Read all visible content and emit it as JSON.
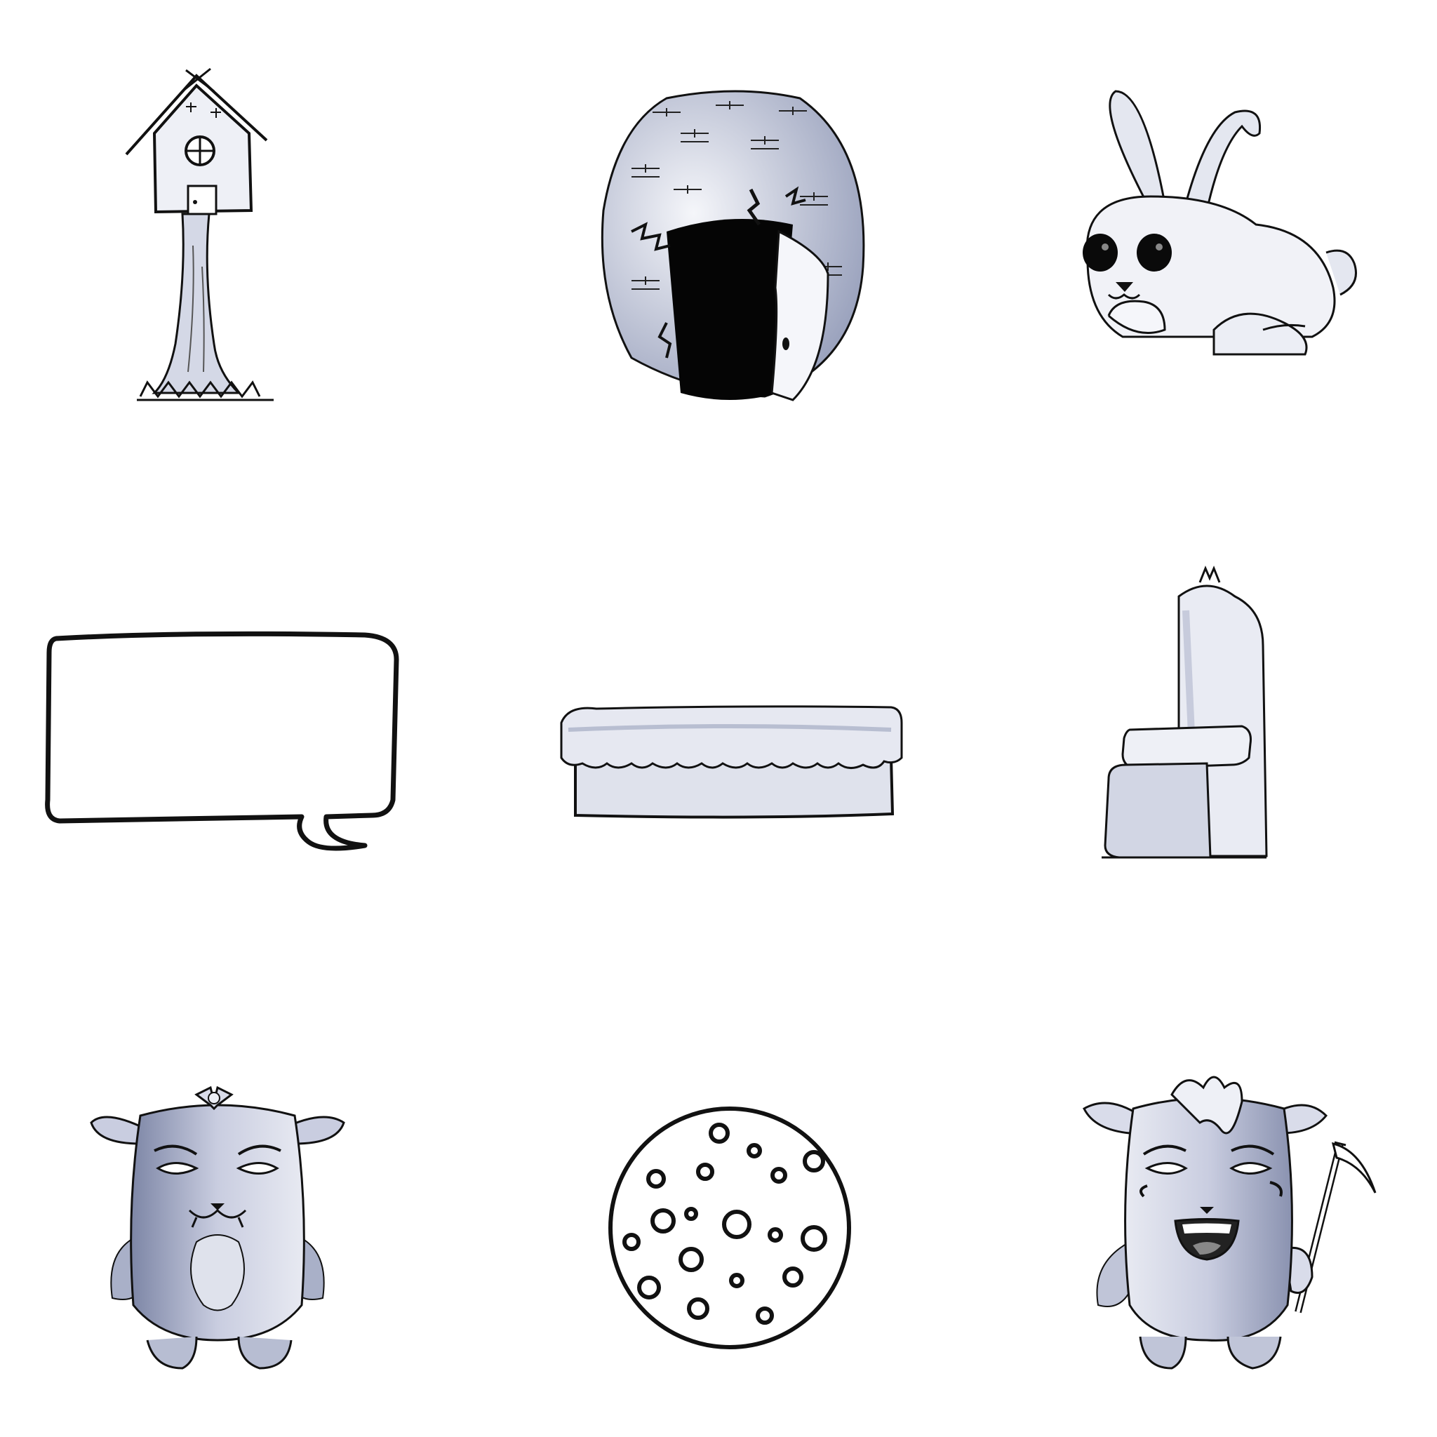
{
  "sheet": {
    "background": "#ffffff",
    "ink": "#111111",
    "shade": "#c7ccdc",
    "shade_dark": "#9aa2bd",
    "items": [
      {
        "name": "tree-house",
        "icon": "tree-house-icon"
      },
      {
        "name": "egg-house",
        "icon": "egg-house-icon"
      },
      {
        "name": "bunny",
        "icon": "bunny-icon"
      },
      {
        "name": "speech-bubble",
        "icon": "speech-bubble-icon"
      },
      {
        "name": "cushion-platform",
        "icon": "cushion-platform-icon"
      },
      {
        "name": "armchair",
        "icon": "armchair-icon"
      },
      {
        "name": "goat-girl",
        "icon": "goat-girl-icon"
      },
      {
        "name": "spotted-cookie",
        "icon": "cookie-icon"
      },
      {
        "name": "goat-reaper",
        "icon": "goat-reaper-icon"
      }
    ]
  }
}
